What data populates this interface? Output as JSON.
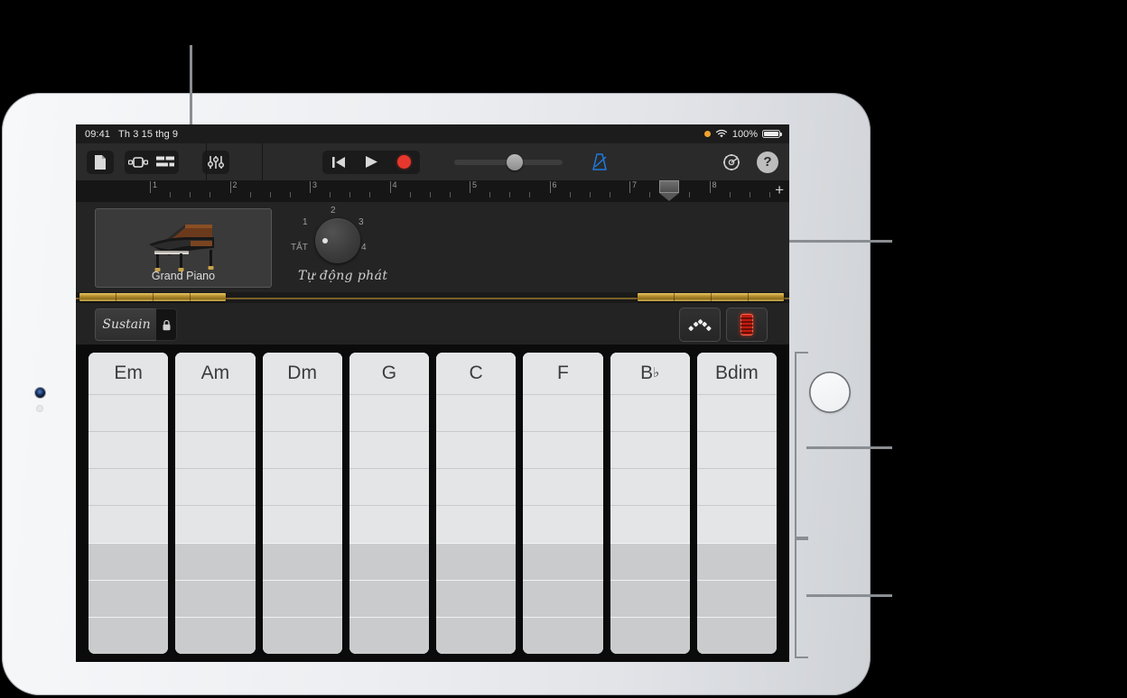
{
  "status_bar": {
    "time": "09:41",
    "date": "Th 3 15 thg 9",
    "battery_percent": "100%",
    "wifi_icon": "wifi-icon",
    "recording_indicator": "orange-dot-icon",
    "battery_icon": "battery-icon"
  },
  "toolbar": {
    "browser_button": "document-icon",
    "view_button": "tracks-view-icon",
    "list_button": "track-list-icon",
    "mixer_button": "mixer-sliders-icon",
    "rewind_button": "rewind-icon",
    "play_button": "play-icon",
    "record_button": "record-icon",
    "volume_slider": "master-volume-slider",
    "metronome_button": "metronome-icon",
    "settings_button": "gear-icon",
    "help_button": "?"
  },
  "ruler": {
    "measures": [
      "1",
      "2",
      "3",
      "4",
      "5",
      "6",
      "7",
      "8"
    ],
    "playhead_measure": "7.5",
    "add_button": "+"
  },
  "track": {
    "instrument_name": "Grand Piano",
    "instrument_icon": "grand-piano-icon"
  },
  "autoplay": {
    "label": "Tự động phát",
    "off_label": "TẮT",
    "positions": [
      "1",
      "2",
      "3",
      "4"
    ],
    "selected": "TẮT"
  },
  "controls": {
    "sustain_label": "Sustain",
    "lock_icon": "lock-icon",
    "arpeggiator_button": "arpeggiator-icon",
    "glissando_button": "red-led-strip-icon"
  },
  "chords": {
    "strips": [
      {
        "name": "Em",
        "root": "Em",
        "accidental": ""
      },
      {
        "name": "Am",
        "root": "Am",
        "accidental": ""
      },
      {
        "name": "Dm",
        "root": "Dm",
        "accidental": ""
      },
      {
        "name": "G",
        "root": "G",
        "accidental": ""
      },
      {
        "name": "C",
        "root": "C",
        "accidental": ""
      },
      {
        "name": "F",
        "root": "F",
        "accidental": ""
      },
      {
        "name": "B♭",
        "root": "B",
        "accidental": "♭"
      },
      {
        "name": "Bdim",
        "root": "Bdim",
        "accidental": ""
      }
    ],
    "light_rows": 4,
    "dark_rows": 3
  },
  "colors": {
    "accent_blue": "#1f7ae0",
    "record_red": "#e8372c",
    "gold_rail": "#b9922f",
    "screen_bg": "#0b0b0b"
  }
}
